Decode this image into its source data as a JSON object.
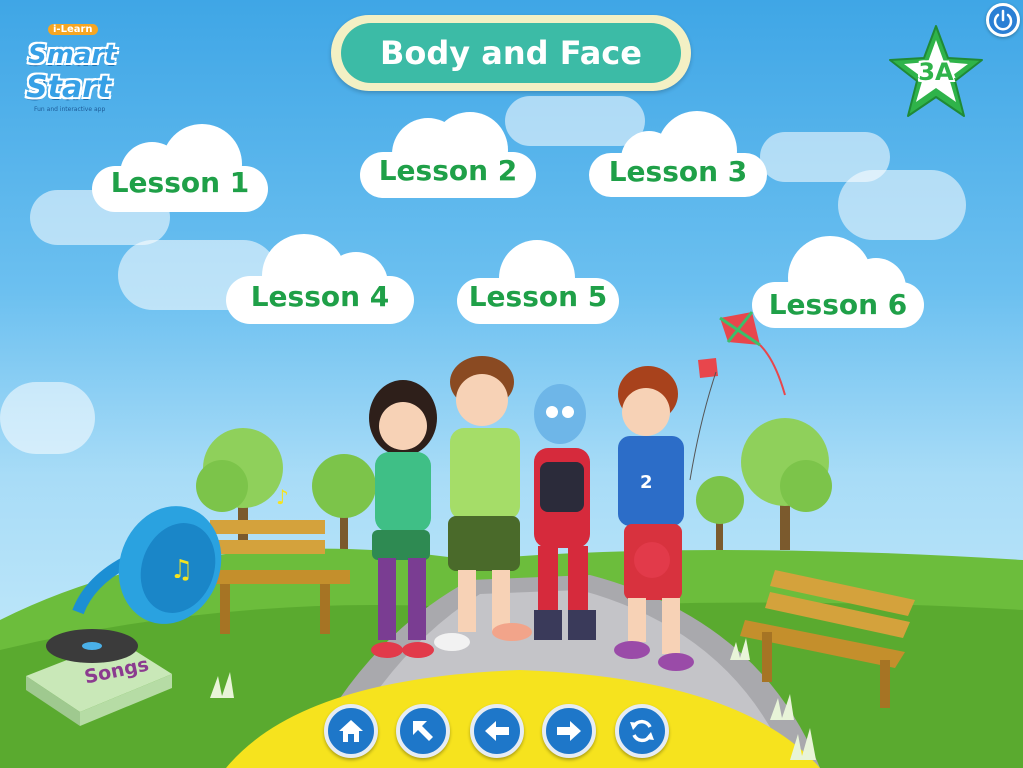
{
  "app": {
    "logo_top": "i-Learn",
    "logo_word1": "Smart",
    "logo_word2": "Start",
    "logo_tagline": "Fun and interactive app"
  },
  "header": {
    "title": "Body and Face",
    "level_badge": "3A"
  },
  "lessons": [
    {
      "label": "Lesson 1"
    },
    {
      "label": "Lesson 2"
    },
    {
      "label": "Lesson 3"
    },
    {
      "label": "Lesson 4"
    },
    {
      "label": "Lesson 5"
    },
    {
      "label": "Lesson 6"
    }
  ],
  "songs": {
    "label": "Songs"
  },
  "nav_buttons": [
    {
      "icon": "home-icon"
    },
    {
      "icon": "arrow-up-left-icon"
    },
    {
      "icon": "arrow-left-icon"
    },
    {
      "icon": "arrow-right-icon"
    },
    {
      "icon": "refresh-icon"
    }
  ],
  "colors": {
    "title_bg": "#3cbba6",
    "lesson_text": "#1fa048",
    "nav_button": "#1e77c9",
    "badge_green": "#2fb34a"
  }
}
